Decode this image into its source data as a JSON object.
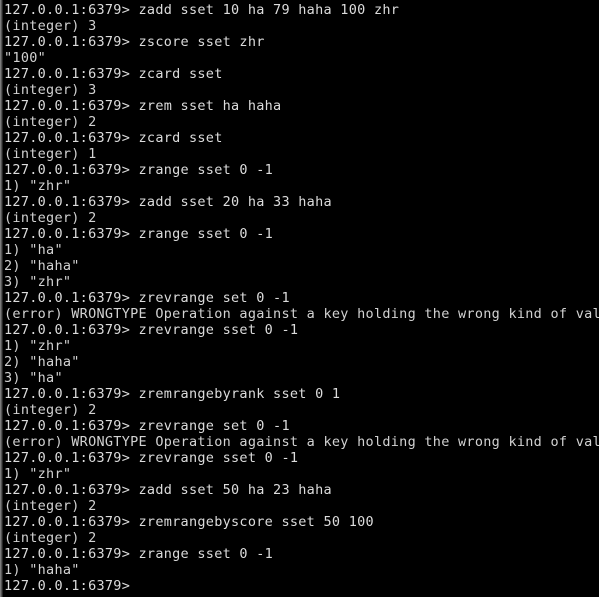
{
  "terminal": {
    "app": "redis-cli",
    "prompt": "127.0.0.1:6379>",
    "colors": {
      "background": "#000000",
      "foreground": "#d8d8d8",
      "edge": "#8a8a8a"
    },
    "lines": [
      {
        "kind": "prompt",
        "text": "127.0.0.1:6379> zadd sset 10 ha 79 haha 100 zhr"
      },
      {
        "kind": "output",
        "text": "(integer) 3"
      },
      {
        "kind": "prompt",
        "text": "127.0.0.1:6379> zscore sset zhr"
      },
      {
        "kind": "output",
        "text": "\"100\""
      },
      {
        "kind": "prompt",
        "text": "127.0.0.1:6379> zcard sset"
      },
      {
        "kind": "output",
        "text": "(integer) 3"
      },
      {
        "kind": "prompt",
        "text": "127.0.0.1:6379> zrem sset ha haha"
      },
      {
        "kind": "output",
        "text": "(integer) 2"
      },
      {
        "kind": "prompt",
        "text": "127.0.0.1:6379> zcard sset"
      },
      {
        "kind": "output",
        "text": "(integer) 1"
      },
      {
        "kind": "prompt",
        "text": "127.0.0.1:6379> zrange sset 0 -1"
      },
      {
        "kind": "output",
        "text": "1) \"zhr\""
      },
      {
        "kind": "prompt",
        "text": "127.0.0.1:6379> zadd sset 20 ha 33 haha"
      },
      {
        "kind": "output",
        "text": "(integer) 2"
      },
      {
        "kind": "prompt",
        "text": "127.0.0.1:6379> zrange sset 0 -1"
      },
      {
        "kind": "output",
        "text": "1) \"ha\""
      },
      {
        "kind": "output",
        "text": "2) \"haha\""
      },
      {
        "kind": "output",
        "text": "3) \"zhr\""
      },
      {
        "kind": "prompt",
        "text": "127.0.0.1:6379> zrevrange set 0 -1"
      },
      {
        "kind": "error",
        "text": "(error) WRONGTYPE Operation against a key holding the wrong kind of value"
      },
      {
        "kind": "prompt",
        "text": "127.0.0.1:6379> zrevrange sset 0 -1"
      },
      {
        "kind": "output",
        "text": "1) \"zhr\""
      },
      {
        "kind": "output",
        "text": "2) \"haha\""
      },
      {
        "kind": "output",
        "text": "3) \"ha\""
      },
      {
        "kind": "prompt",
        "text": "127.0.0.1:6379> zremrangebyrank sset 0 1"
      },
      {
        "kind": "output",
        "text": "(integer) 2"
      },
      {
        "kind": "prompt",
        "text": "127.0.0.1:6379> zrevrange set 0 -1"
      },
      {
        "kind": "error",
        "text": "(error) WRONGTYPE Operation against a key holding the wrong kind of value"
      },
      {
        "kind": "prompt",
        "text": "127.0.0.1:6379> zrevrange sset 0 -1"
      },
      {
        "kind": "output",
        "text": "1) \"zhr\""
      },
      {
        "kind": "prompt",
        "text": "127.0.0.1:6379> zadd sset 50 ha 23 haha"
      },
      {
        "kind": "output",
        "text": "(integer) 2"
      },
      {
        "kind": "prompt",
        "text": "127.0.0.1:6379> zremrangebyscore sset 50 100"
      },
      {
        "kind": "output",
        "text": "(integer) 2"
      },
      {
        "kind": "prompt",
        "text": "127.0.0.1:6379> zrange sset 0 -1"
      },
      {
        "kind": "output",
        "text": "1) \"haha\""
      },
      {
        "kind": "prompt",
        "text": "127.0.0.1:6379>"
      }
    ]
  }
}
